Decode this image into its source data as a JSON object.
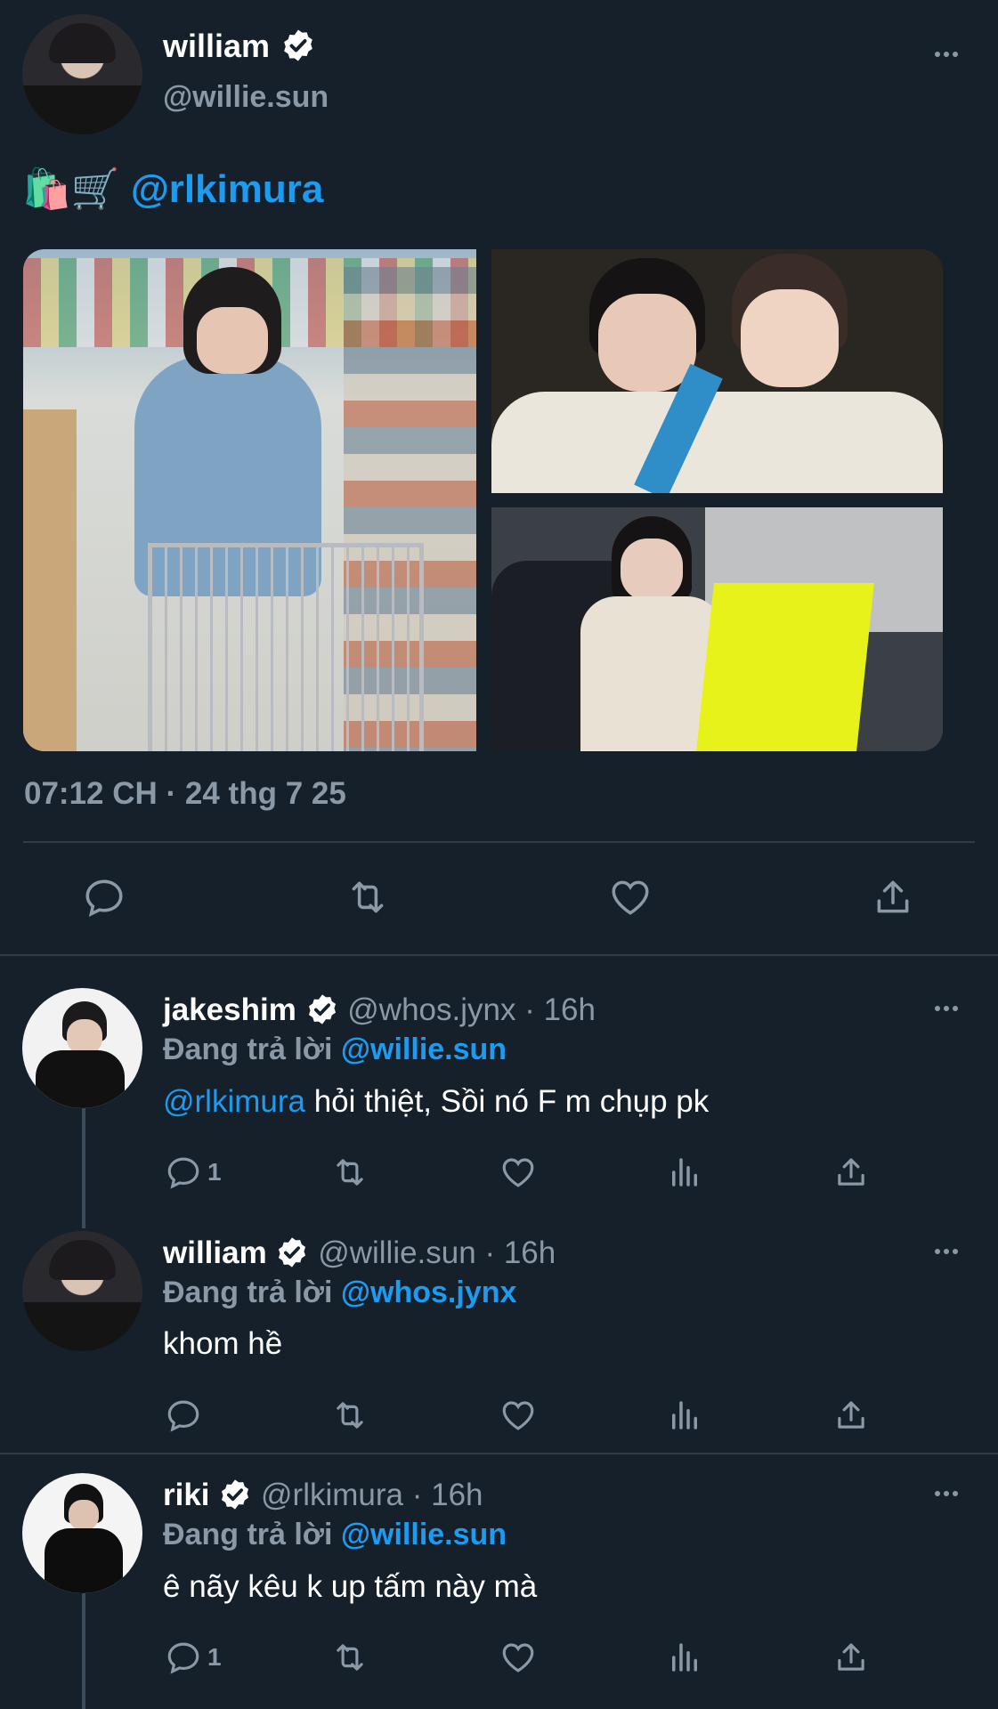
{
  "main_tweet": {
    "display_name": "william",
    "handle": "@willie.sun",
    "emojis": "🛍️🛒",
    "mention": "@rlkimura",
    "timestamp": "07:12 CH · 24 thg 7 25"
  },
  "replies": [
    {
      "display_name": "jakeshim",
      "handle_time": "@whos.jynx · 16h",
      "replying_prefix": "Đang trả lời",
      "replying_to": "@willie.sun",
      "mention": "@rlkimura",
      "text": " hỏi thiệt, Sồi nó F m chụp pk",
      "reply_count": "1"
    },
    {
      "display_name": "william",
      "handle_time": "@willie.sun · 16h",
      "replying_prefix": "Đang trả lời",
      "replying_to": "@whos.jynx",
      "text": "khom hề",
      "reply_count": ""
    },
    {
      "display_name": "riki",
      "handle_time": "@rlkimura · 16h",
      "replying_prefix": "Đang trả lời",
      "replying_to": "@willie.sun",
      "text": "ê nãy kêu k up tấm này mà",
      "reply_count": "1"
    }
  ],
  "colors": {
    "background": "#15202b",
    "accent": "#1d9bf0",
    "muted": "#8b98a5",
    "divider": "#2f3b47"
  }
}
